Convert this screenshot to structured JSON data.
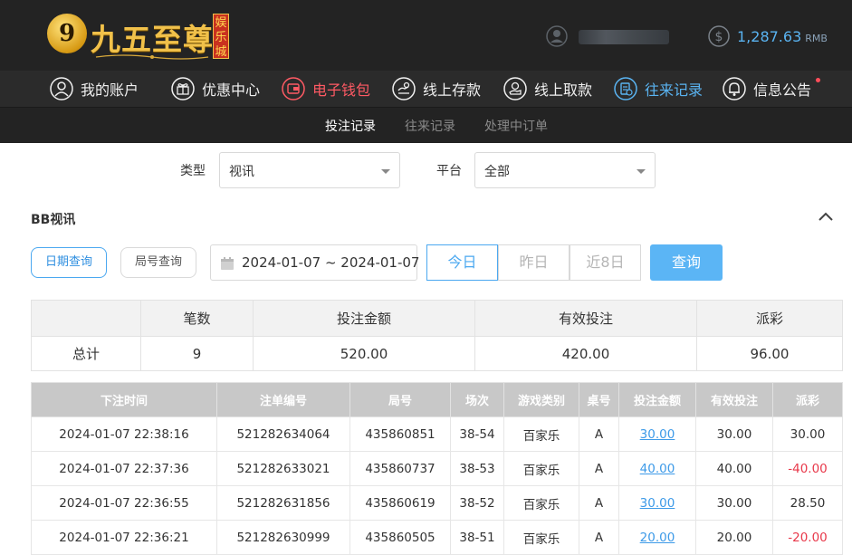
{
  "header": {
    "logo_badge": "9",
    "logo_text": "九五至尊",
    "logo_tag": "娱乐城",
    "balance_amount": "1,287.63",
    "balance_currency": "RMB"
  },
  "nav": {
    "items": [
      {
        "label": "我的账户",
        "icon": "user-circle-icon"
      },
      {
        "label": "优惠中心",
        "icon": "gift-icon"
      },
      {
        "label": "电子钱包",
        "icon": "wallet-icon"
      },
      {
        "label": "线上存款",
        "icon": "deposit-icon"
      },
      {
        "label": "线上取款",
        "icon": "withdraw-icon"
      },
      {
        "label": "往来记录",
        "icon": "records-icon"
      },
      {
        "label": "信息公告",
        "icon": "bell-icon"
      }
    ]
  },
  "subnav": {
    "tabs": [
      "投注记录",
      "往来记录",
      "处理中订单"
    ]
  },
  "filters": {
    "type_label": "类型",
    "type_value": "视讯",
    "platform_label": "平台",
    "platform_value": "全部"
  },
  "section": {
    "title": "BB视讯"
  },
  "query": {
    "date_query": "日期查询",
    "round_query": "局号查询",
    "date_range": "2024-01-07 ~ 2024-01-07",
    "today": "今日",
    "yesterday": "昨日",
    "last8": "近8日",
    "search": "查询"
  },
  "summary": {
    "headers": [
      "",
      "笔数",
      "投注金额",
      "有效投注",
      "派彩"
    ],
    "row": [
      "总计",
      "9",
      "520.00",
      "420.00",
      "96.00"
    ]
  },
  "detail": {
    "headers": [
      "下注时间",
      "注单编号",
      "局号",
      "场次",
      "游戏类别",
      "桌号",
      "投注金额",
      "有效投注",
      "派彩"
    ],
    "rows": [
      [
        "2024-01-07 22:38:16",
        "521282634064",
        "435860851",
        "38-54",
        "百家乐",
        "A",
        "30.00",
        "30.00",
        "30.00"
      ],
      [
        "2024-01-07 22:37:36",
        "521282633021",
        "435860737",
        "38-53",
        "百家乐",
        "A",
        "40.00",
        "40.00",
        "-40.00"
      ],
      [
        "2024-01-07 22:36:55",
        "521282631856",
        "435860619",
        "38-52",
        "百家乐",
        "A",
        "30.00",
        "30.00",
        "28.50"
      ],
      [
        "2024-01-07 22:36:21",
        "521282630999",
        "435860505",
        "38-51",
        "百家乐",
        "A",
        "20.00",
        "20.00",
        "-20.00"
      ]
    ]
  },
  "colors": {
    "accent": "#5bb5f5",
    "nav_active_red": "#ff5a64",
    "nav_active_blue": "#5ab4f2",
    "negative": "#e8384a"
  }
}
